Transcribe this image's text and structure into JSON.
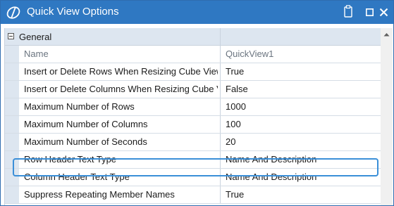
{
  "window": {
    "title": "Quick View Options",
    "accent": "#2f78c2"
  },
  "icons": {
    "app": "onestream-logo-icon",
    "clipboard": "clipboard-icon",
    "maximize": "maximize-icon",
    "close": "close-icon",
    "collapse": "collapse-icon",
    "scroll_up": "scroll-up-icon"
  },
  "category": {
    "label": "General"
  },
  "header": {
    "name": "Name",
    "value": "QuickView1"
  },
  "properties": [
    {
      "name": "Insert or Delete Rows When Resizing Cube View",
      "value": "True"
    },
    {
      "name": "Insert or Delete Columns When Resizing Cube View",
      "value": "False"
    },
    {
      "name": "Maximum Number of Rows",
      "value": "1000"
    },
    {
      "name": "Maximum Number of Columns",
      "value": "100"
    },
    {
      "name": "Maximum Number of Seconds",
      "value": "20"
    },
    {
      "name": "Row Header Text Type",
      "value": "Name And Description"
    },
    {
      "name": "Column Header Text Type",
      "value": "Name And Description"
    },
    {
      "name": "Suppress Repeating Member Names",
      "value": "True"
    }
  ],
  "selection_color": "#3a8fd8"
}
